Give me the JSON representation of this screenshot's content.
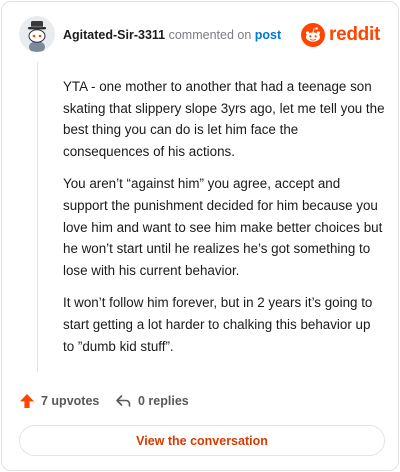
{
  "header": {
    "username": "Agitated-Sir-3311",
    "action": "commented on",
    "post_link": "post",
    "brand": "reddit"
  },
  "comment": {
    "paragraphs": [
      "YTA - one mother to another that had a teenage son skating that slippery slope 3yrs ago, let me tell you the best thing you can do is let him face the consequences of his actions.",
      "You aren’t “against him” you agree, accept and support the punishment decided for him because you love him and want to see him make better choices but he won’t start until he realizes he’s got something to lose with his current behavior.",
      "It won’t follow him forever, but in 2 years it’s going to start getting a lot harder to chalking this behavior up to ”dumb kid stuff”."
    ]
  },
  "footer": {
    "upvotes": "7 upvotes",
    "replies": "0 replies",
    "view_button": "View the conversation"
  },
  "colors": {
    "brand": "#ff4500",
    "link": "#0079d3",
    "upvote": "#ff4500",
    "button_text": "#d93a00"
  },
  "icons": {
    "avatar": "snoo-avatar-with-hat",
    "brand_logo": "reddit-snoo-icon",
    "upvote": "arrow-up-icon",
    "reply": "reply-arrow-icon"
  }
}
